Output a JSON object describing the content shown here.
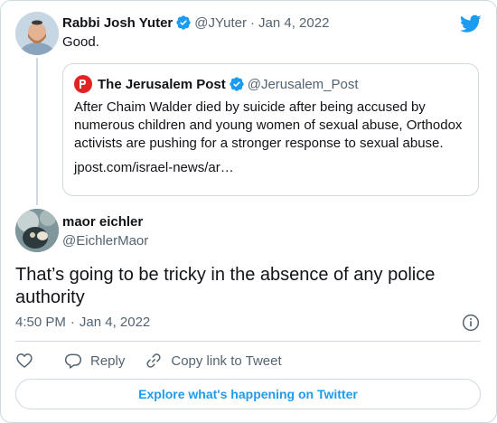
{
  "parent_tweet": {
    "author_name": "Rabbi Josh Yuter",
    "handle": "@JYuter",
    "separator": "·",
    "date": "Jan 4, 2022",
    "text": "Good.",
    "quoted": {
      "author_name": "The Jerusalem Post",
      "handle": "@Jerusalem_Post",
      "text": "After Chaim Walder died by suicide after being accused by numerous children and young women of sexual abuse, Orthodox activists are pushing for a stronger response to sexual abuse.",
      "link": "jpost.com/israel-news/ar…"
    }
  },
  "main_tweet": {
    "author_name": "maor eichler",
    "handle": "@EichlerMaor",
    "text": "That’s going to be tricky in the absence of any police authority",
    "time": "4:50 PM",
    "separator": "·",
    "date": "Jan 4, 2022"
  },
  "actions": {
    "reply_label": "Reply",
    "copy_label": "Copy link to Tweet"
  },
  "explore_label": "Explore what's happening on Twitter",
  "colors": {
    "twitter_blue": "#1d9bf0",
    "verified_blue": "#1d9bf0",
    "secondary_text": "#536471",
    "border": "#cfd9de"
  },
  "icons": [
    "twitter-logo-icon",
    "verified-badge-icon",
    "info-icon",
    "like-heart-icon",
    "reply-icon",
    "link-icon"
  ]
}
